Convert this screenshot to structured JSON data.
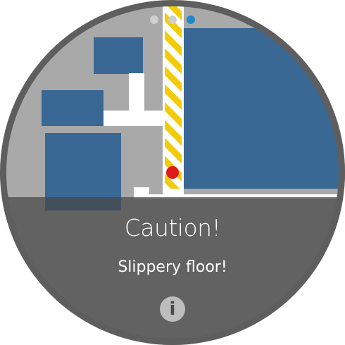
{
  "pager": {
    "pages": 3,
    "active_index": 2
  },
  "notification": {
    "title": "Caution!",
    "message": "Slippery floor!",
    "info_icon_glyph": "i"
  },
  "colors": {
    "room": "#3a6895",
    "floor": "#a9a9a9",
    "corridor": "#ffffff",
    "hazard_stripe_yellow": "#f2cc0c",
    "location_marker": "#e0191b",
    "active_page_dot": "#1e88c8",
    "inactive_page_dot": "#cfcfcf"
  },
  "icons": {
    "info": "info-icon",
    "location": "location-marker-icon"
  }
}
